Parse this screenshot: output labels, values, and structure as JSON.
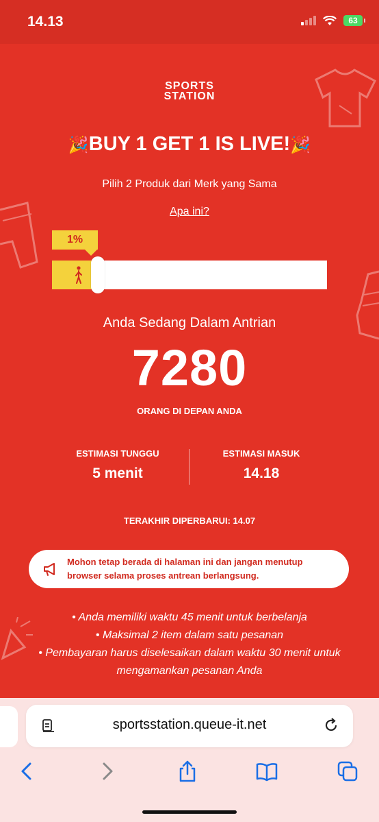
{
  "status_bar": {
    "time": "14.13",
    "battery": "63"
  },
  "brand": {
    "line1": "SPORTS",
    "line2": "STATION"
  },
  "headline": {
    "text": "BUY 1 GET 1 IS LIVE!",
    "emoji": "🎉"
  },
  "subtitle": "Pilih 2 Produk dari Merk yang Sama",
  "help_link": "Apa ini?",
  "progress": {
    "label": "1%",
    "value": 0.01
  },
  "queue": {
    "label": "Anda Sedang Dalam Antrian",
    "number": "7280",
    "sub": "ORANG DI DEPAN ANDA"
  },
  "estimates": {
    "wait_label": "ESTIMASI TUNGGU",
    "wait_value": "5 menit",
    "entry_label": "ESTIMASI MASUK",
    "entry_value": "14.18"
  },
  "last_updated": "TERAKHIR DIPERBARUI: 14.07",
  "notice": "Mohon tetap berada di halaman ini dan jangan menutup browser selama proses antrean berlangsung.",
  "info": [
    "• Anda memiliki waktu 45 menit untuk berbelanja",
    "• Maksimal 2 item dalam satu pesanan",
    "• Pembayaran harus diselesaikan dalam waktu 30 menit untuk mengamankan pesanan Anda"
  ],
  "browser": {
    "url": "sportsstation.queue-it.net"
  },
  "colors": {
    "background": "#e33226",
    "accent": "#f4d23c",
    "text_red": "#d12a1f"
  }
}
